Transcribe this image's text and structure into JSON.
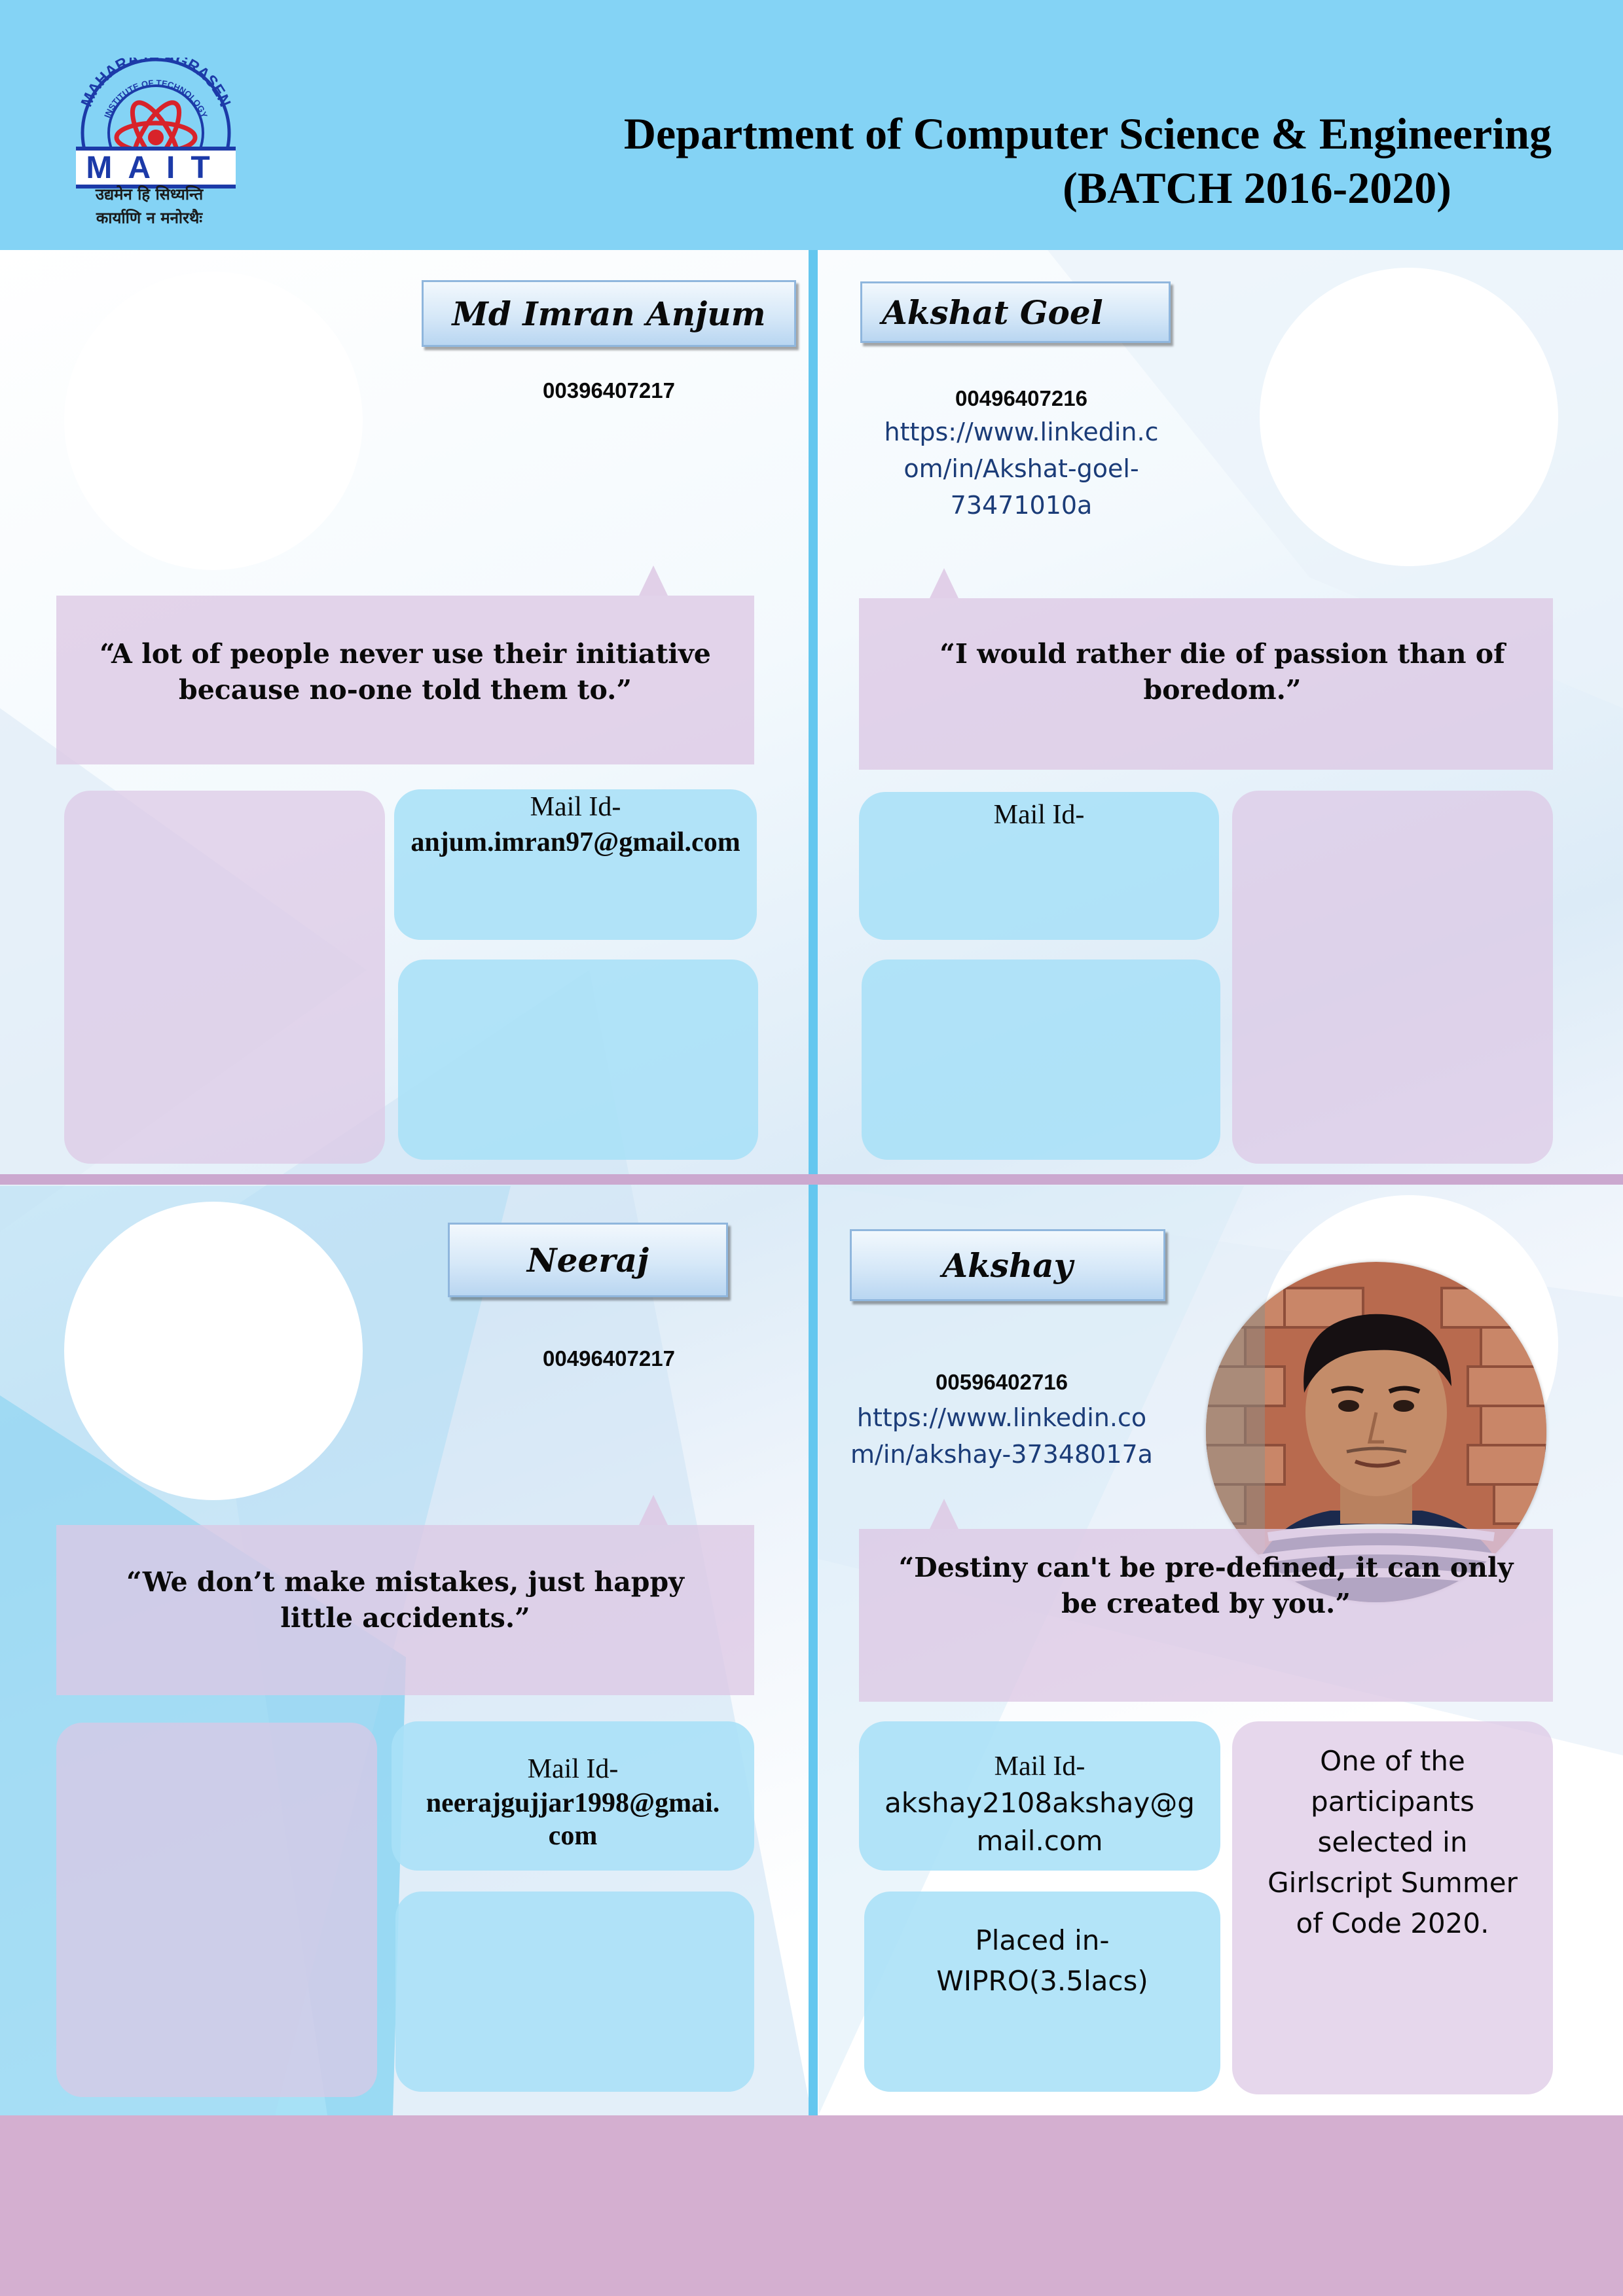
{
  "header": {
    "logo": {
      "arc_text": "MAHARAJA AGRASEN",
      "arc_text_inner": "INSTITUTE OF TECHNOLOGY",
      "acronym": "MAIT",
      "motto_line1": "उद्यमेन हि सिध्यन्ति",
      "motto_line2": "कार्याणि न मनोरथैः"
    },
    "title_line1": "Department of Computer Science & Engineering",
    "title_line2": "(BATCH 2016-2020)"
  },
  "students": [
    {
      "name": "Md Imran Anjum",
      "roll": "00396407217",
      "linkedin": "",
      "quote_line1": "“A lot of people never use their initiative",
      "quote_line2": "because no-one told them to.”",
      "mail_label": "Mail Id-",
      "mail_line1": "anjum.imran97@gmail.com",
      "mail_line2": ""
    },
    {
      "name": "Akshat Goel",
      "roll": "00496407216",
      "linkedin_line1": "https://www.linkedin.c",
      "linkedin_line2": "om/in/Akshat-goel-",
      "linkedin_line3": "73471010a",
      "quote_line1": "“I would rather die of passion than of",
      "quote_line2": "boredom.”",
      "mail_label": "Mail Id-"
    },
    {
      "name": "Neeraj",
      "roll": "00496407217",
      "quote_line1": "“We don’t make mistakes, just happy",
      "quote_line2": "little accidents.”",
      "mail_label": "Mail Id-",
      "mail_line1": "neerajgujjar1998@gmai.",
      "mail_line2": "com"
    },
    {
      "name": "Akshay",
      "roll": "00596402716",
      "linkedin_line1": "https://www.linkedin.co",
      "linkedin_line2": "m/in/akshay-37348017a",
      "quote_line1": "“Destiny can't be pre-defined, it can only",
      "quote_line2": "be created by you.”",
      "mail_label": "Mail Id-",
      "mail_line1": "akshay2108akshay@g",
      "mail_line2": "mail.com",
      "placed_line1": "Placed in-",
      "placed_line2": "WIPRO(3.5lacs)",
      "achievement_lines": [
        "One of the",
        "participants",
        "selected in",
        "Girlscript Summer",
        "of Code 2020."
      ]
    }
  ],
  "colors": {
    "header_bg": "#84d3f5",
    "footer_bg": "#d4afd0",
    "divider_blue": "#64c7ef",
    "divider_pink": "#cba8cf",
    "quote_box": "#ddc8e4",
    "info_box_blue": "#a9e0f7",
    "logo_blue": "#1c3aa8",
    "logo_red": "#d8232a"
  }
}
